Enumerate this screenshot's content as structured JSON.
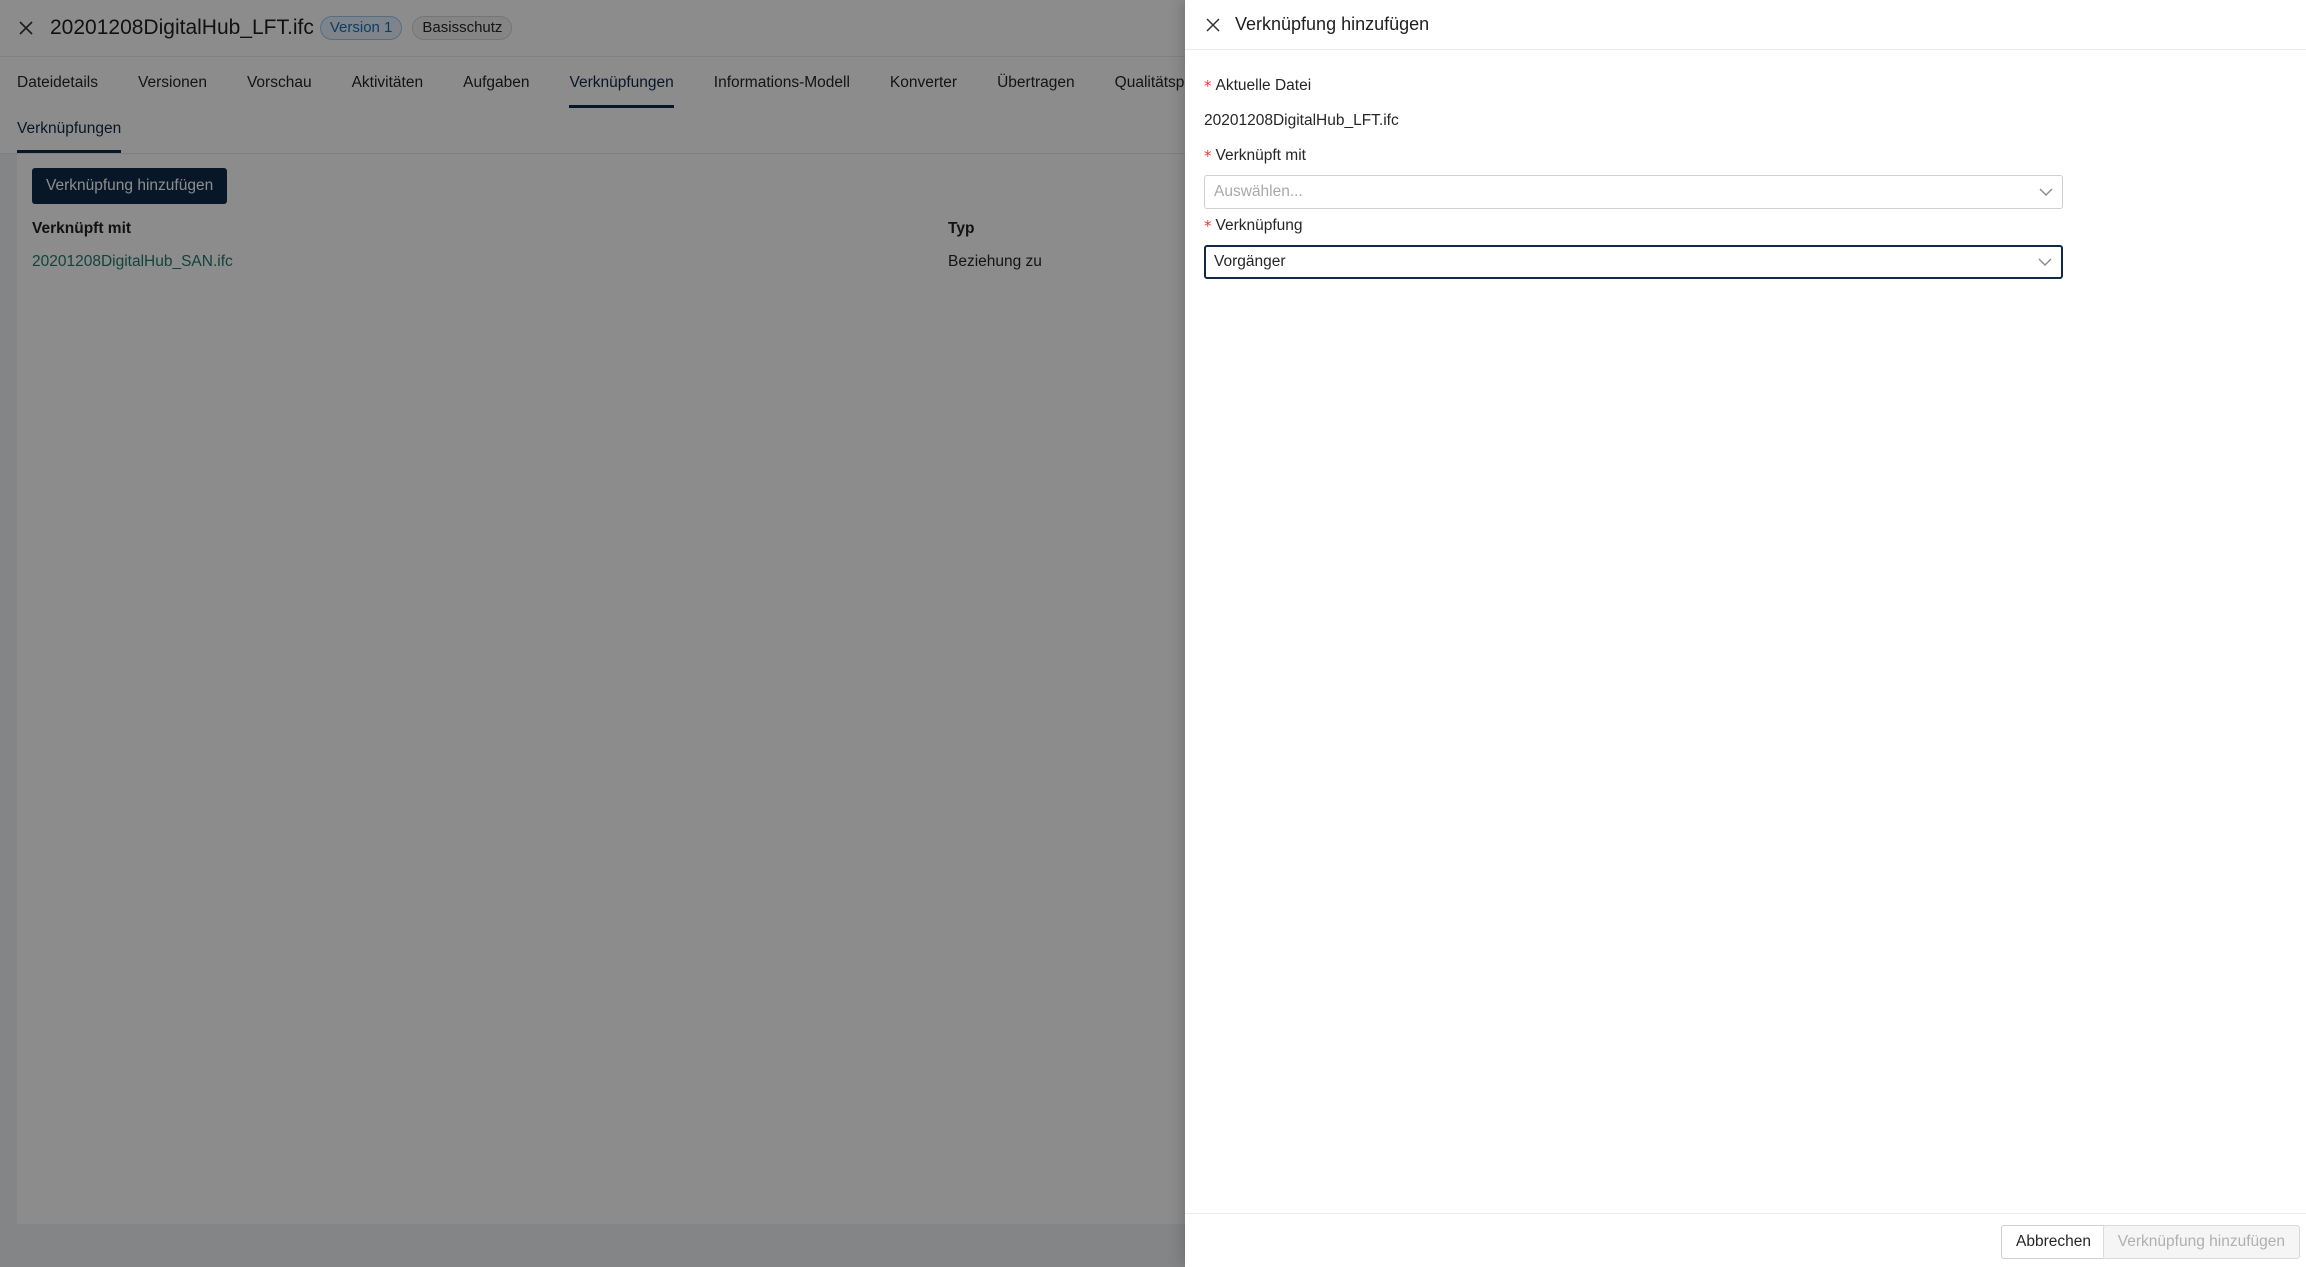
{
  "page": {
    "title": "20201208DigitalHub_LFT.ifc",
    "version_badge": "Version 1",
    "protection_badge": "Basisschutz",
    "tabs": [
      {
        "label": "Dateidetails",
        "active": false
      },
      {
        "label": "Versionen",
        "active": false
      },
      {
        "label": "Vorschau",
        "active": false
      },
      {
        "label": "Aktivitäten",
        "active": false
      },
      {
        "label": "Aufgaben",
        "active": false
      },
      {
        "label": "Verknüpfungen",
        "active": true
      },
      {
        "label": "Informations-Modell",
        "active": false
      },
      {
        "label": "Konverter",
        "active": false
      },
      {
        "label": "Übertragen",
        "active": false
      },
      {
        "label": "Qualitätsprüfu",
        "active": false
      }
    ],
    "subtab": "Verknüpfungen",
    "add_button": "Verknüpfung hinzufügen",
    "table": {
      "headers": [
        "Verknüpft mit",
        "Typ"
      ],
      "rows": [
        {
          "linked_with": "20201208DigitalHub_SAN.ifc",
          "type": "Beziehung zu"
        }
      ]
    }
  },
  "drawer": {
    "title": "Verknüpfung hinzufügen",
    "fields": {
      "current_file": {
        "label": "Aktuelle Datei",
        "value": "20201208DigitalHub_LFT.ifc",
        "required": "*"
      },
      "linked_with": {
        "label": "Verknüpft mit",
        "placeholder": "Auswählen...",
        "required": "*"
      },
      "link_type": {
        "label": "Verknüpfung",
        "value": "Vorgänger",
        "required": "*"
      }
    },
    "footer": {
      "cancel": "Abbrechen",
      "submit": "Verknüpfung hinzufügen"
    }
  },
  "colors": {
    "primary": "#0e2a47",
    "required": "#e03b3b",
    "link": "#1f7a6a",
    "overlay": "rgba(0,0,0,0.45)"
  }
}
